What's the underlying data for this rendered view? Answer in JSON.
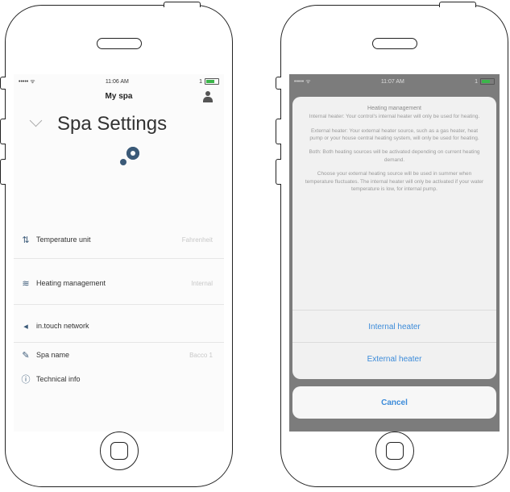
{
  "left_screen": {
    "status": {
      "carrier": "•••••  ᯤ",
      "time": "11:06 AM",
      "battery_pct": "1"
    },
    "nav_title": "My spa",
    "page_title": "Spa Settings",
    "menu": [
      {
        "icon": "thermometer-icon",
        "label": "Temperature unit",
        "value": "Fahrenheit"
      },
      {
        "icon": "heating-waves-icon",
        "label": "Heating management",
        "value": "Internal"
      },
      {
        "icon": "network-icon",
        "label": "in.touch network",
        "value": ""
      },
      {
        "icon": "spa-name-icon",
        "label": "Spa name",
        "value": "Bacco 1"
      },
      {
        "icon": "info-icon",
        "label": "Technical info",
        "value": ""
      }
    ]
  },
  "right_screen": {
    "status": {
      "carrier": "•••••  ᯤ",
      "time": "11:07 AM",
      "battery_pct": "1"
    },
    "sheet": {
      "title": "Heating management",
      "paragraphs": [
        "Internal heater: Your control's internal heater will only be used for heating.",
        "External heater: Your external heater source, such as a gas heater, heat pump or your house central heating system, will only be used for heating.",
        "Both: Both heating sources will be activated depending on current heating demand.",
        "Choose your external heating source will be used in summer when temperature fluctuates. The internal heater will only be activated if your water temperature is low, for internal pump."
      ],
      "actions": [
        "Internal heater",
        "External heater"
      ],
      "cancel": "Cancel"
    }
  }
}
